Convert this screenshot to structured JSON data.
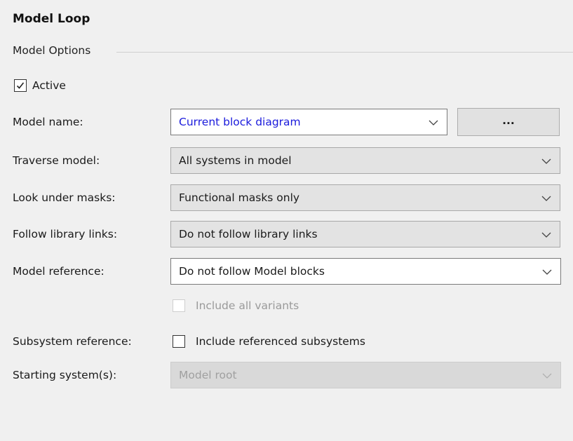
{
  "panel": {
    "title": "Model Loop",
    "group_label": "Model Options"
  },
  "active": {
    "label": "Active",
    "checked": true
  },
  "rows": {
    "model_name": {
      "label": "Model name:",
      "value": "Current block diagram",
      "browse_label": "..."
    },
    "traverse_model": {
      "label": "Traverse model:",
      "value": "All systems in model"
    },
    "look_under_masks": {
      "label": "Look under masks:",
      "value": "Functional masks only"
    },
    "follow_library_links": {
      "label": "Follow library links:",
      "value": "Do not follow library links"
    },
    "model_reference": {
      "label": "Model reference:",
      "value": "Do not follow Model blocks"
    },
    "include_all_variants": {
      "label": "Include all variants",
      "checked": false,
      "enabled": false
    },
    "subsystem_reference": {
      "label": "Subsystem reference:",
      "checkbox_label": "Include referenced subsystems",
      "checked": false
    },
    "starting_systems": {
      "label": "Starting system(s):",
      "value": "Model root",
      "enabled": false
    }
  },
  "colors": {
    "panel_background": "#f0f0f0",
    "model_name_value": "#1a1adc",
    "disabled_text": "#9a9a9a"
  },
  "icons": {
    "checkmark": "check-icon",
    "dropdown": "chevron-down-icon"
  }
}
